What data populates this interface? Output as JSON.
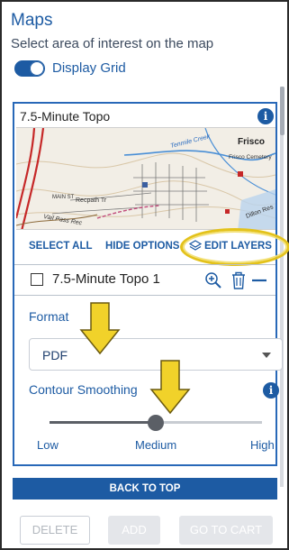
{
  "header": {
    "title": "Maps",
    "subtitle": "Select area of interest on the map",
    "toggle_label": "Display Grid",
    "toggle_on": true
  },
  "panel": {
    "title": "7.5-Minute Topo",
    "info_icon": "info-icon",
    "map": {
      "labels": [
        "Frisco",
        "Frisco Cemetery",
        "Tenmile Creek",
        "MAIN ST",
        "Recpath Tr",
        "Vail Pass Rec",
        "Dillon Res"
      ]
    },
    "actions": {
      "select_all": "SELECT ALL",
      "hide_options": "HIDE OPTIONS",
      "edit_layers": "EDIT LAYERS"
    },
    "layer": {
      "label": "7.5-Minute Topo 1",
      "checked": false,
      "icons": [
        "zoom-in-icon",
        "trash-icon",
        "minus-icon"
      ]
    },
    "format": {
      "label": "Format",
      "value": "PDF"
    },
    "smoothing": {
      "label": "Contour Smoothing",
      "level": 0.5,
      "ticks": [
        "Low",
        "Medium",
        "High"
      ]
    }
  },
  "back_to_top": "BACK TO TOP",
  "footer": {
    "delete": "DELETE",
    "add": "ADD",
    "go_to_cart": "GO TO CART"
  },
  "colors": {
    "accent": "#1d5ba3",
    "highlight": "#e3c21a"
  }
}
